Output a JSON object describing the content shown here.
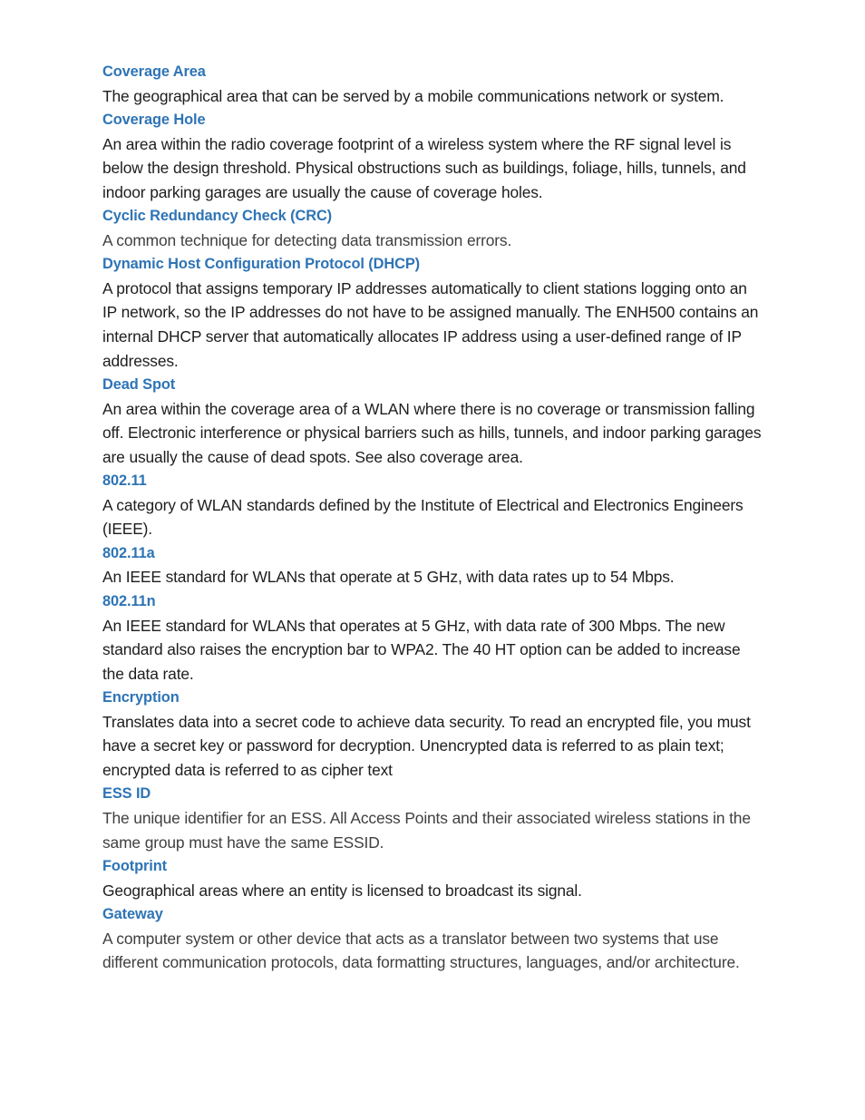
{
  "document": {
    "type": "glossary-page",
    "colors": {
      "page_background": "#ffffff",
      "term_heading": "#2E74B5",
      "body_text": "#1d1d1d"
    },
    "entries": [
      {
        "term": "Coverage Area",
        "definition": "The geographical area that can be served by a mobile communications network or system."
      },
      {
        "term": "Coverage Hole",
        "definition": "An area within the radio coverage footprint of a wireless system where the RF signal level is below the design threshold. Physical obstructions such as buildings, foliage, hills, tunnels, and indoor parking garages are usually the cause of coverage holes."
      },
      {
        "term": "Cyclic Redundancy Check (CRC)",
        "definition": "A common technique for detecting data transmission errors."
      },
      {
        "term": "Dynamic Host Configuration Protocol (DHCP)",
        "definition": "A protocol that assigns temporary IP addresses automatically to client stations logging onto an IP network, so the IP addresses do not have to be assigned manually. The ENH500 contains an internal DHCP server that automatically allocates IP address using a user-defined range of IP addresses."
      },
      {
        "term": "Dead Spot",
        "definition": "An area within the coverage area of a WLAN where there is no coverage or transmission falling off. Electronic interference or physical barriers such as hills, tunnels, and indoor parking garages are usually the cause of dead spots. See also coverage area."
      },
      {
        "term": "802.11",
        "definition": "A category of WLAN standards defined by the Institute of Electrical and Electronics Engineers (IEEE)."
      },
      {
        "term": "802.11a",
        "definition": "An IEEE standard for WLANs that operate at 5 GHz, with data rates up to 54 Mbps."
      },
      {
        "term": "802.11n",
        "definition": "An IEEE standard for WLANs that operates at 5 GHz, with data rate of 300 Mbps. The new standard also raises the encryption bar to WPA2. The 40 HT option can be added to increase the data rate."
      },
      {
        "term": "Encryption",
        "definition": "Translates data into a secret code to achieve data security. To read an encrypted file, you must have a secret key or password for decryption. Unencrypted data is referred to as plain text; encrypted data is referred to as cipher text"
      },
      {
        "term": "ESS ID",
        "definition": "The unique identifier for an ESS. All Access Points and their associated wireless stations in the same group must have the same ESSID."
      },
      {
        "term": "Footprint",
        "definition": "Geographical areas where an entity is licensed to broadcast its signal."
      },
      {
        "term": "Gateway",
        "definition": "A computer system or other device that acts as a translator between two systems that use different communication protocols, data formatting structures, languages, and/or architecture."
      }
    ]
  }
}
